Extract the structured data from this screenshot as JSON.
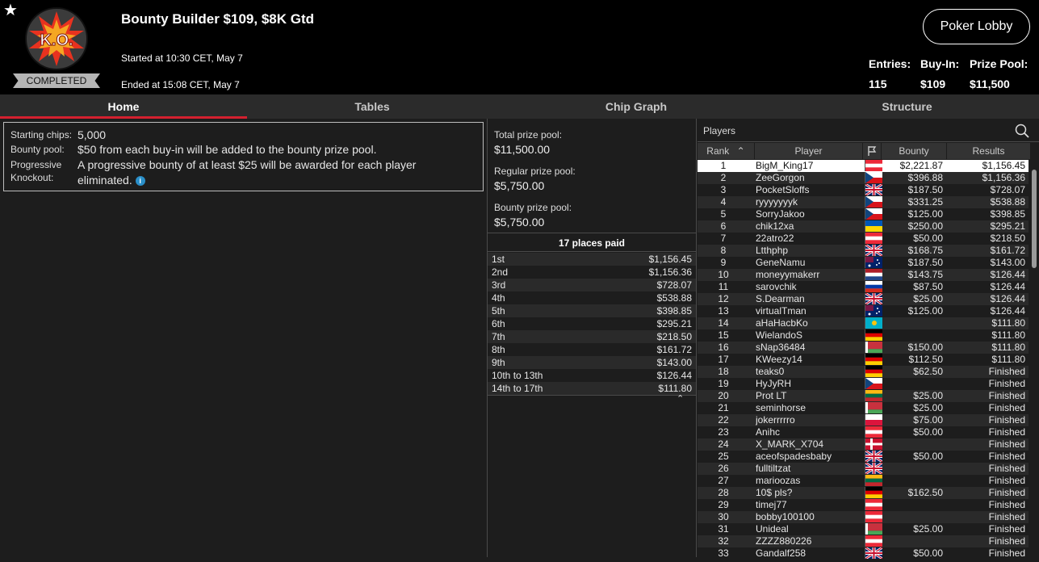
{
  "header": {
    "title": "Bounty Builder $109, $8K Gtd",
    "started": "Started at 10:30 CET, May 7",
    "ended": "Ended at 15:08 CET, May 7",
    "status_badge": "COMPLETED",
    "logo_text": "K.O.",
    "lobby_button": "Poker Lobby",
    "stats": [
      {
        "label": "Entries:",
        "value": "115"
      },
      {
        "label": "Buy-In:",
        "value": "$109"
      },
      {
        "label": "Prize Pool:",
        "value": "$11,500"
      }
    ]
  },
  "tabs": [
    "Home",
    "Tables",
    "Chip Graph",
    "Structure"
  ],
  "active_tab": "Home",
  "info": {
    "starting_label": "Starting chips:",
    "starting_value": "5,000",
    "bounty_label": "Bounty pool:",
    "bounty_value": "$50 from each buy-in will be added to the bounty prize pool.",
    "pko_label_1": "Progressive",
    "pko_label_2": "Knockout:",
    "pko_value_1": "A progressive bounty of at least $25 will be awarded for each player",
    "pko_value_2": "eliminated.",
    "info_icon": "i"
  },
  "pools": {
    "total_label": "Total prize pool:",
    "total_value": "$11,500.00",
    "regular_label": "Regular prize pool:",
    "regular_value": "$5,750.00",
    "bounty_label": "Bounty prize pool:",
    "bounty_value": "$5,750.00"
  },
  "places_paid": "17 places paid",
  "payouts": [
    [
      "1st",
      "$1,156.45"
    ],
    [
      "2nd",
      "$1,156.36"
    ],
    [
      "3rd",
      "$728.07"
    ],
    [
      "4th",
      "$538.88"
    ],
    [
      "5th",
      "$398.85"
    ],
    [
      "6th",
      "$295.21"
    ],
    [
      "7th",
      "$218.50"
    ],
    [
      "8th",
      "$161.72"
    ],
    [
      "9th",
      "$143.00"
    ],
    [
      "10th to 13th",
      "$126.44"
    ],
    [
      "14th to 17th",
      "$111.80"
    ]
  ],
  "players": {
    "title": "Players",
    "columns": {
      "rank": "Rank",
      "player": "Player",
      "bounty": "Bounty",
      "results": "Results"
    },
    "rows": [
      [
        "1",
        "BigM_King17",
        "$2,221.87",
        "$1,156.45",
        "at"
      ],
      [
        "2",
        "ZeeGorgon",
        "$396.88",
        "$1,156.36",
        "cz"
      ],
      [
        "3",
        "PocketSloffs",
        "$187.50",
        "$728.07",
        "gb"
      ],
      [
        "4",
        "ryyyyyyyk",
        "$331.25",
        "$538.88",
        "cz"
      ],
      [
        "5",
        "SorryJakoo",
        "$125.00",
        "$398.85",
        "cz"
      ],
      [
        "6",
        "chik12xa",
        "$250.00",
        "$295.21",
        "ua"
      ],
      [
        "7",
        "22atro22",
        "$50.00",
        "$218.50",
        "at"
      ],
      [
        "8",
        "Ltthphp",
        "$168.75",
        "$161.72",
        "gb"
      ],
      [
        "9",
        "GeneNamu",
        "$187.50",
        "$143.00",
        "au"
      ],
      [
        "10",
        "moneyymakerr",
        "$143.75",
        "$126.44",
        "nl"
      ],
      [
        "11",
        "sarovchik",
        "$87.50",
        "$126.44",
        "ru"
      ],
      [
        "12",
        "S.Dearman",
        "$25.00",
        "$126.44",
        "gb"
      ],
      [
        "13",
        "virtualTman",
        "$125.00",
        "$126.44",
        "au"
      ],
      [
        "14",
        "aHaHacbKo",
        "",
        "$111.80",
        "kz"
      ],
      [
        "15",
        "WielandoS",
        "",
        "$111.80",
        "de"
      ],
      [
        "16",
        "sNap36484",
        "$150.00",
        "$111.80",
        "by"
      ],
      [
        "17",
        "KWeezy14",
        "$112.50",
        "$111.80",
        "de"
      ],
      [
        "18",
        "teaks0",
        "$62.50",
        "Finished",
        "de"
      ],
      [
        "19",
        "HyJyRH",
        "",
        "Finished",
        "cz"
      ],
      [
        "20",
        "Prot LT",
        "$25.00",
        "Finished",
        "lt"
      ],
      [
        "21",
        "seminhorse",
        "$25.00",
        "Finished",
        "by"
      ],
      [
        "22",
        "jokerrrrro",
        "$75.00",
        "Finished",
        "pl"
      ],
      [
        "23",
        "Anihc",
        "$50.00",
        "Finished",
        "at"
      ],
      [
        "24",
        "X_MARK_X704",
        "",
        "Finished",
        "dk"
      ],
      [
        "25",
        "aceofspadesbaby",
        "$50.00",
        "Finished",
        "gb"
      ],
      [
        "26",
        "fulltiltzat",
        "",
        "Finished",
        "gb"
      ],
      [
        "27",
        "marioozas",
        "",
        "Finished",
        "lt"
      ],
      [
        "28",
        "10$ pls?",
        "$162.50",
        "Finished",
        "de"
      ],
      [
        "29",
        "timej77",
        "",
        "Finished",
        "at"
      ],
      [
        "30",
        "bobby100100",
        "",
        "Finished",
        "at"
      ],
      [
        "31",
        "Unideal",
        "$25.00",
        "Finished",
        "by"
      ],
      [
        "32",
        "ZZZZ880226",
        "",
        "Finished",
        "at"
      ],
      [
        "33",
        "Gandalf258",
        "$50.00",
        "Finished",
        "gb"
      ]
    ]
  },
  "colors": {
    "accent": "#d4202f",
    "row_alt": "#2a2a2a",
    "selected_row": "#ffffff"
  }
}
